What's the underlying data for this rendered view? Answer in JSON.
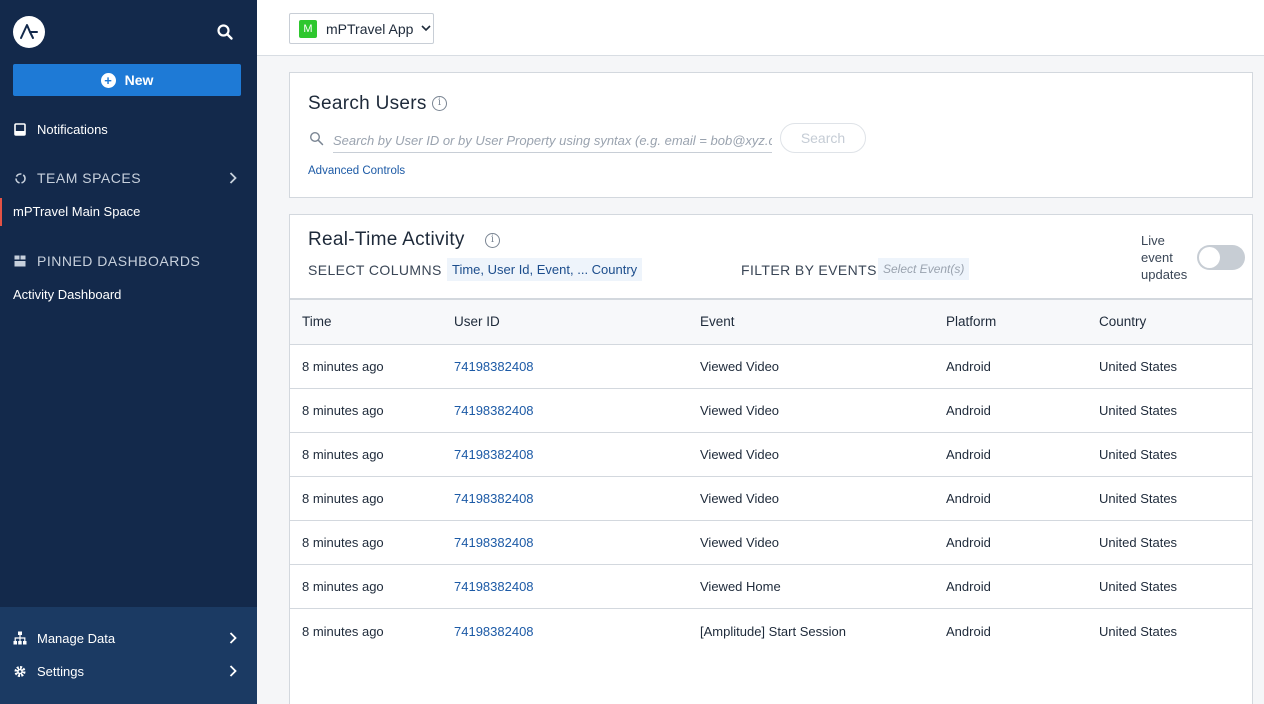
{
  "sidebar": {
    "new_label": "New",
    "notifications_label": "Notifications",
    "team_spaces_label": "TEAM SPACES",
    "main_space_label": "mPTravel Main Space",
    "pinned_label": "PINNED DASHBOARDS",
    "activity_dashboard_label": "Activity Dashboard",
    "manage_data_label": "Manage Data",
    "settings_label": "Settings"
  },
  "topbar": {
    "app_badge": "M",
    "app_name": "mPTravel App"
  },
  "search_users": {
    "title": "Search Users",
    "placeholder": "Search by User ID or by User Property using syntax (e.g. email = bob@xyz.com)",
    "button_label": "Search",
    "advanced_link": "Advanced Controls"
  },
  "realtime": {
    "title": "Real-Time Activity",
    "select_columns_label": "SELECT COLUMNS",
    "columns_chip": "Time, User Id, Event, ... Country",
    "filter_label": "FILTER BY EVENTS",
    "filter_placeholder": "Select Event(s)",
    "live_label": "Live event updates",
    "live_enabled": false,
    "headers": [
      "Time",
      "User ID",
      "Event",
      "Platform",
      "Country"
    ],
    "rows": [
      {
        "time": "8 minutes ago",
        "user_id": "74198382408",
        "event": "Viewed Video",
        "platform": "Android",
        "country": "United States"
      },
      {
        "time": "8 minutes ago",
        "user_id": "74198382408",
        "event": "Viewed Video",
        "platform": "Android",
        "country": "United States"
      },
      {
        "time": "8 minutes ago",
        "user_id": "74198382408",
        "event": "Viewed Video",
        "platform": "Android",
        "country": "United States"
      },
      {
        "time": "8 minutes ago",
        "user_id": "74198382408",
        "event": "Viewed Video",
        "platform": "Android",
        "country": "United States"
      },
      {
        "time": "8 minutes ago",
        "user_id": "74198382408",
        "event": "Viewed Video",
        "platform": "Android",
        "country": "United States"
      },
      {
        "time": "8 minutes ago",
        "user_id": "74198382408",
        "event": "Viewed Home",
        "platform": "Android",
        "country": "United States"
      },
      {
        "time": "8 minutes ago",
        "user_id": "74198382408",
        "event": "[Amplitude] Start Session",
        "platform": "Android",
        "country": "United States"
      }
    ]
  },
  "colors": {
    "sidebar_bg": "#13294b",
    "accent_blue": "#1e7ad6",
    "link_blue": "#1c5aa6",
    "app_badge_green": "#2ec72e"
  }
}
